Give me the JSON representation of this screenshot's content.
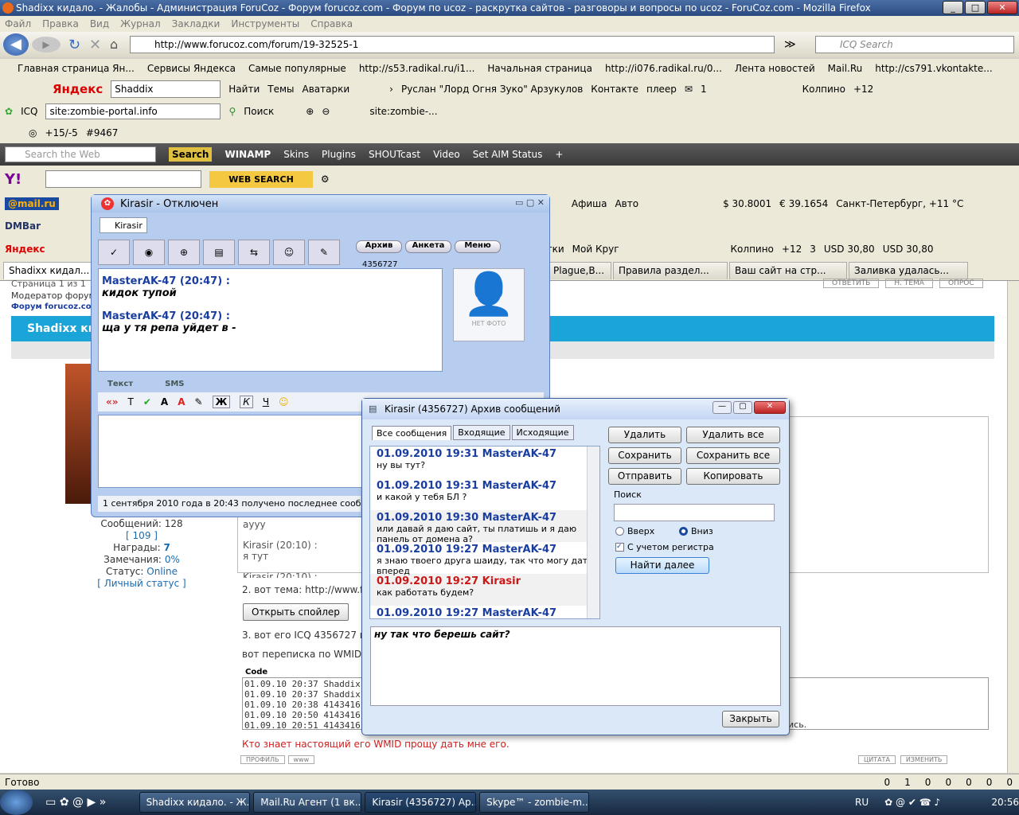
{
  "window": {
    "title": "Shadixx кидало. - Жалобы - Администрация ForuCoz - Форум forucoz.com - Форум по ucoz - раскрутка сайтов - разговоры и вопросы по ucoz - ForuCoz.com - Mozilla Firefox"
  },
  "menu": [
    "Файл",
    "Правка",
    "Вид",
    "Журнал",
    "Закладки",
    "Инструменты",
    "Справка"
  ],
  "nav": {
    "url": "http://www.forucoz.com/forum/19-32525-1",
    "search_placeholder": "ICQ Search"
  },
  "bookmarks": [
    "Главная страница Ян...",
    "Сервисы Яндекса",
    "Самые популярные",
    "http://s53.radikal.ru/i1...",
    "Начальная страница",
    "http://i076.radikal.ru/0...",
    "Лента новостей",
    "Mail.Ru",
    "http://cs791.vkontakte..."
  ],
  "yandex_bar": {
    "search_value": "Shaddix",
    "find": "Найти",
    "themes": "Темы",
    "avatars": "Аватарки",
    "user": "Руслан \"Лорд Огня Зуко\" Арзукулов",
    "vk": "Контакте",
    "player": "плеер",
    "mail_count": "1",
    "city": "Колпино",
    "temp": "+12"
  },
  "icq_bar": {
    "label": "ICQ",
    "site": "site:zombie-portal.info",
    "search": "Поиск",
    "site_short": "site:zombie-..."
  },
  "rating_bar": {
    "rating": "+15/-5",
    "num": "#9467"
  },
  "winamp_bar": {
    "search_placeholder": "Search the Web",
    "search_btn": "Search",
    "winamp": "WINAMP",
    "items": [
      "Skins",
      "Plugins",
      "SHOUTcast",
      "Video",
      "Set AIM Status"
    ]
  },
  "yahoo_bar": {
    "web_search": "WEB SEARCH"
  },
  "mailru_bar": {
    "afisha": "Афиша",
    "auto": "Авто",
    "usd": "$ 30.8001",
    "eur": "€ 39.1654",
    "weather": "Санкт-Петербург, +11 °C"
  },
  "dmbar": {
    "label": "DMBar"
  },
  "yandex_bar2": {
    "label": "Яндекс",
    "items": [
      "тки",
      "Мой Круг"
    ],
    "city": "Колпино",
    "temp": "+12",
    "num": "3",
    "usd1": "USD 30,80",
    "usd2": "USD 30,80"
  },
  "tabs": [
    "Shadixx кидал...",
    "Plague,B...",
    "Правила раздел...",
    "Ваш сайт на стр...",
    "Заливка удалась..."
  ],
  "page": {
    "pages": "Страница 1 из 1",
    "moderator": "Модератор форум",
    "forum_link": "Форум forucoz.com",
    "topic": "Shadixx кид",
    "post_count_label": "Сообщений: 128",
    "post_count_link": "[ 109 ]",
    "awards": "Награды:",
    "awards_val": "7",
    "warnings": "Замечания:",
    "warnings_val": "0%",
    "status": "Статус:",
    "status_val": "Online",
    "personal_status": "[ Личный статус ]",
    "quote_lines": [
      "аууу",
      "Kirasir (20:10) :",
      "я тут",
      "Kirasir (20:10) :"
    ],
    "line2": "2. вот тема: http://www.fo",
    "spoiler": "Открыть спойлер",
    "line3": "3. вот его ICQ 4356727 и",
    "wmid_text": "вот переписка по WMID",
    "code_label": "Code",
    "code_lines": [
      "01.09.10 20:37   Shaddix:",
      "01.09.10 20:37   Shaddix:",
      "01.09.10 20:38   4143416",
      "01.09.10 20:50   4143416",
      "01.09.10 20:51   4143416"
    ],
    "code_tail": "ись.",
    "red_text": "Кто знает настоящий его WMID прощу дать мне его.",
    "reply_btns": [
      "ОТВЕТИТЬ",
      "Н. ТЕМА",
      "ОПРОС"
    ],
    "bottom_btns": [
      "ЦИТАТА",
      "ИЗМЕНИТЬ"
    ],
    "profile_btns": [
      "ПРОФИЛЬ",
      "www"
    ]
  },
  "status": "Готово",
  "status_counts": [
    "0",
    "1",
    "0",
    "0",
    "0",
    "0",
    "0"
  ],
  "icq": {
    "title": "Kirasir - Отключен",
    "tab": "Kirasir",
    "btns": [
      "Архив",
      "Анкета",
      "Меню"
    ],
    "uin": "4356727",
    "photo": "НЕТ ФОТО",
    "messages": [
      {
        "who": "MasterAK-47 (20:47) :",
        "text": "кидок тупой"
      },
      {
        "who": "MasterAK-47 (20:47) :",
        "text": "ща у тя репа уйдет в -"
      }
    ],
    "tab_text": "Текст",
    "tab_sms": "SMS",
    "quote": "«»",
    "bold": "Ж",
    "italic": "К",
    "underline": "Ч",
    "status_line": "1 сентября 2010 года в 20:43 получено последнее сообщение"
  },
  "archive": {
    "title": "Kirasir (4356727) Архив сообщений",
    "tabs": [
      "Все сообщения",
      "Входящие",
      "Исходящие"
    ],
    "messages": [
      {
        "head": "01.09.2010 19:31 MasterAK-47",
        "text": "ну вы тут?",
        "red": false
      },
      {
        "head": "01.09.2010 19:31 MasterAK-47",
        "text": "и какой у тебя БЛ ?",
        "red": false
      },
      {
        "head": "01.09.2010 19:30 MasterAK-47",
        "text": "или давай я даю сайт, ты платишь и я даю панель от домена а?",
        "red": false
      },
      {
        "head": "01.09.2010 19:27 MasterAK-47",
        "text": "я знаю твоего друга шаиду, так что могу дать вперед",
        "red": false
      },
      {
        "head": "01.09.2010 19:27 Kirasir",
        "text": "как работать будем?",
        "red": true
      },
      {
        "head": "01.09.2010 19:27 MasterAK-47",
        "text": "",
        "red": false
      }
    ],
    "buttons": {
      "delete": "Удалить",
      "delete_all": "Удалить все",
      "save": "Сохранить",
      "save_all": "Сохранить все",
      "send": "Отправить",
      "copy": "Копировать"
    },
    "search_label": "Поиск",
    "up": "Вверх",
    "down": "Вниз",
    "case": "С учетом регистра",
    "find_next": "Найти далее",
    "preview": "ну так что берешь сайт?",
    "close": "Закрыть"
  },
  "taskbar": {
    "items": [
      "Shadixx кидало. - Ж...",
      "Mail.Ru Агент (1 вк...",
      "Kirasir (4356727) Ар...",
      "Skype™ - zombie-m..."
    ],
    "lang": "RU",
    "time": "20:56"
  }
}
